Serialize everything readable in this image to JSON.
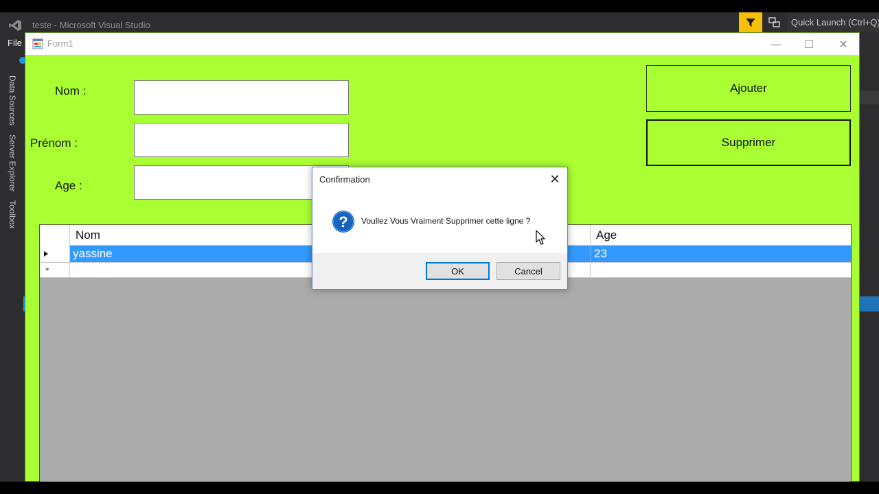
{
  "ide": {
    "title": "teste - Microsoft Visual Studio",
    "quick_launch": "Quick Launch (Ctrl+Q)",
    "menu_file": "File",
    "side_tabs": [
      "Data Sources",
      "Server Explorer",
      "Toolbox"
    ],
    "accent": "#f7bf06"
  },
  "form": {
    "title": "Form1",
    "background": "#aaff33",
    "labels": {
      "nom": "Nom :",
      "prenom": "Prénom :",
      "age": "Age :"
    },
    "fields": {
      "nom": "",
      "prenom": "",
      "age": ""
    },
    "buttons": {
      "ajouter": "Ajouter",
      "supprimer": "Supprimer"
    },
    "window_buttons": {
      "minimize": "—",
      "maximize": "☐",
      "close": "✕"
    }
  },
  "grid": {
    "columns": [
      "Nom",
      "Age"
    ],
    "rows": [
      {
        "nom": "yassine",
        "age": "23",
        "selected": true
      }
    ],
    "new_row_marker": "*",
    "selection_color": "#3399ff"
  },
  "dialog": {
    "title": "Confirmation",
    "message": "Voullez Vous Vraiment Supprimer cette ligne ?",
    "ok": "OK",
    "cancel": "Cancel",
    "close": "✕",
    "icon": "question-icon"
  }
}
